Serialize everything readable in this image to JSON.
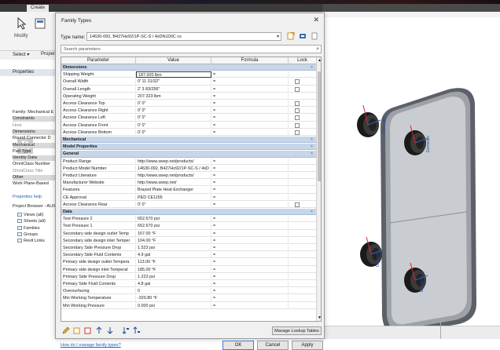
{
  "app": {
    "tab_create": "Create",
    "tab_right_1": "",
    "tab_right_2": "",
    "tab_right_3": "",
    "modify_label": "Modify",
    "select_label": "Select ▾",
    "properties_short": "Propert"
  },
  "left_panel": {
    "properties_header": "Properties",
    "rows": [
      {
        "text": "Family: Mechanical E",
        "shade": false
      },
      {
        "text": "Constraints",
        "shade": true
      },
      {
        "text": "Host",
        "shade": false,
        "muted": true
      },
      {
        "text": "Dimensions",
        "shade": true
      },
      {
        "text": "Round Connector D",
        "shade": false
      },
      {
        "text": "Mechanical",
        "shade": true
      },
      {
        "text": "Part Type",
        "shade": false
      },
      {
        "text": "Identity Data",
        "shade": true
      },
      {
        "text": "OmniClass Number",
        "shade": false
      },
      {
        "text": "OmniClass Title",
        "shade": false,
        "muted": true
      },
      {
        "text": "Other",
        "shade": true
      },
      {
        "text": "Work Plane-Based",
        "shade": false
      }
    ],
    "properties_help": "Properties help",
    "browser_header": "Project Browser - AUX",
    "tree": [
      "Views (all)",
      "Sheets (all)",
      "Families",
      "Groups",
      "Revit Links"
    ]
  },
  "dialog": {
    "title": "Family Types",
    "close": "✕",
    "type_name_label": "Type name:",
    "type_name_value": "14630-092, B427Hx92/1P-SC-S / 4xDN100C cs",
    "search_placeholder": "Search parameters",
    "columns": {
      "parameter": "Parameter",
      "value": "Value",
      "formula": "Formula",
      "lock": "Lock"
    },
    "rows": [
      {
        "type": "group",
        "name": "Dimensions"
      },
      {
        "type": "param",
        "name": "Shipping Weight",
        "value": "187.920 lbm",
        "formula": "=",
        "lock": false,
        "boxed": true
      },
      {
        "type": "param",
        "name": "Overall Width",
        "value": "0'  11 31/32\"",
        "formula": "=",
        "lock": true
      },
      {
        "type": "param",
        "name": "Overall Length",
        "value": "2'  3 83/256\"",
        "formula": "=",
        "lock": true
      },
      {
        "type": "param",
        "name": "Operating Weight",
        "value": "207.323 lbm",
        "formula": "=",
        "lock": false
      },
      {
        "type": "param",
        "name": "Access Clearance Top",
        "value": "0'  0\"",
        "formula": "=",
        "lock": true
      },
      {
        "type": "param",
        "name": "Access Clearance Right",
        "value": "0'  0\"",
        "formula": "=",
        "lock": true
      },
      {
        "type": "param",
        "name": "Access Clearance Left",
        "value": "0'  0\"",
        "formula": "=",
        "lock": true
      },
      {
        "type": "param",
        "name": "Access Clearance Front",
        "value": "0'  0\"",
        "formula": "=",
        "lock": true
      },
      {
        "type": "param",
        "name": "Access Clearance Bottom",
        "value": "0'  0\"",
        "formula": "=",
        "lock": true
      },
      {
        "type": "group",
        "name": "Mechanical"
      },
      {
        "type": "group",
        "name": "Model Properties"
      },
      {
        "type": "group",
        "name": "General"
      },
      {
        "type": "param",
        "name": "Product Range",
        "value": "http://www.swep.net/products/",
        "formula": "=",
        "lock": false
      },
      {
        "type": "param",
        "name": "Product Model Number",
        "value": "14630-092, B427Hx92/1P-SC-S / 4xD",
        "formula": "=",
        "lock": false
      },
      {
        "type": "param",
        "name": "Product Literature",
        "value": "http://www.swep.net/products/",
        "formula": "=",
        "lock": false
      },
      {
        "type": "param",
        "name": "Manufacturer Website",
        "value": "http://www.swep.net/",
        "formula": "=",
        "lock": false
      },
      {
        "type": "param",
        "name": "Features",
        "value": "Brazed Plate Heat Exchanger",
        "formula": "=",
        "lock": false
      },
      {
        "type": "param",
        "name": "CE Approval",
        "value": "PED CE1155",
        "formula": "=",
        "lock": false
      },
      {
        "type": "param",
        "name": "Access Clearance Rear",
        "value": "0'  0\"",
        "formula": "=",
        "lock": true
      },
      {
        "type": "group",
        "name": "Data"
      },
      {
        "type": "param",
        "name": "Test Pressure 2",
        "value": "652.670 psi",
        "formula": "=",
        "lock": false
      },
      {
        "type": "param",
        "name": "Test Pressure 1",
        "value": "652.670 psi",
        "formula": "=",
        "lock": false
      },
      {
        "type": "param",
        "name": "Secondary side design outlet Temp",
        "value": "167.00 °F",
        "formula": "=",
        "lock": false
      },
      {
        "type": "param",
        "name": "Secondary side design inlet Temper",
        "value": "104.00 °F",
        "formula": "=",
        "lock": false
      },
      {
        "type": "param",
        "name": "Secondary Side Pressure Drop",
        "value": "1.523 psi",
        "formula": "=",
        "lock": false
      },
      {
        "type": "param",
        "name": "Secondary Side Fluid Contents",
        "value": "4.9 gal",
        "formula": "=",
        "lock": false
      },
      {
        "type": "param",
        "name": "Primary side design outlet Tempera",
        "value": "113.00 °F",
        "formula": "=",
        "lock": false
      },
      {
        "type": "param",
        "name": "Primary side design inlet Temperat",
        "value": "185.00 °F",
        "formula": "=",
        "lock": false
      },
      {
        "type": "param",
        "name": "Primary Side Pressure Drop",
        "value": "1.223 psi",
        "formula": "=",
        "lock": false
      },
      {
        "type": "param",
        "name": "Primary Side Fluid Contents",
        "value": "4.8 gal",
        "formula": "=",
        "lock": false
      },
      {
        "type": "param",
        "name": "Oversurfacing",
        "value": "0",
        "formula": "=",
        "lock": false
      },
      {
        "type": "param",
        "name": "Min Working Temperature",
        "value": "-320.80 °F",
        "formula": "=",
        "lock": false
      },
      {
        "type": "param",
        "name": "Min Working Pressure",
        "value": "0.000 psi",
        "formula": "=",
        "lock": false
      }
    ],
    "manage_lookup": "Manage Lookup Tables",
    "help_link": "How do I manage family types?",
    "ok": "OK",
    "cancel": "Cancel",
    "apply": "Apply"
  },
  "model": {
    "connector_label": "Domestic"
  }
}
